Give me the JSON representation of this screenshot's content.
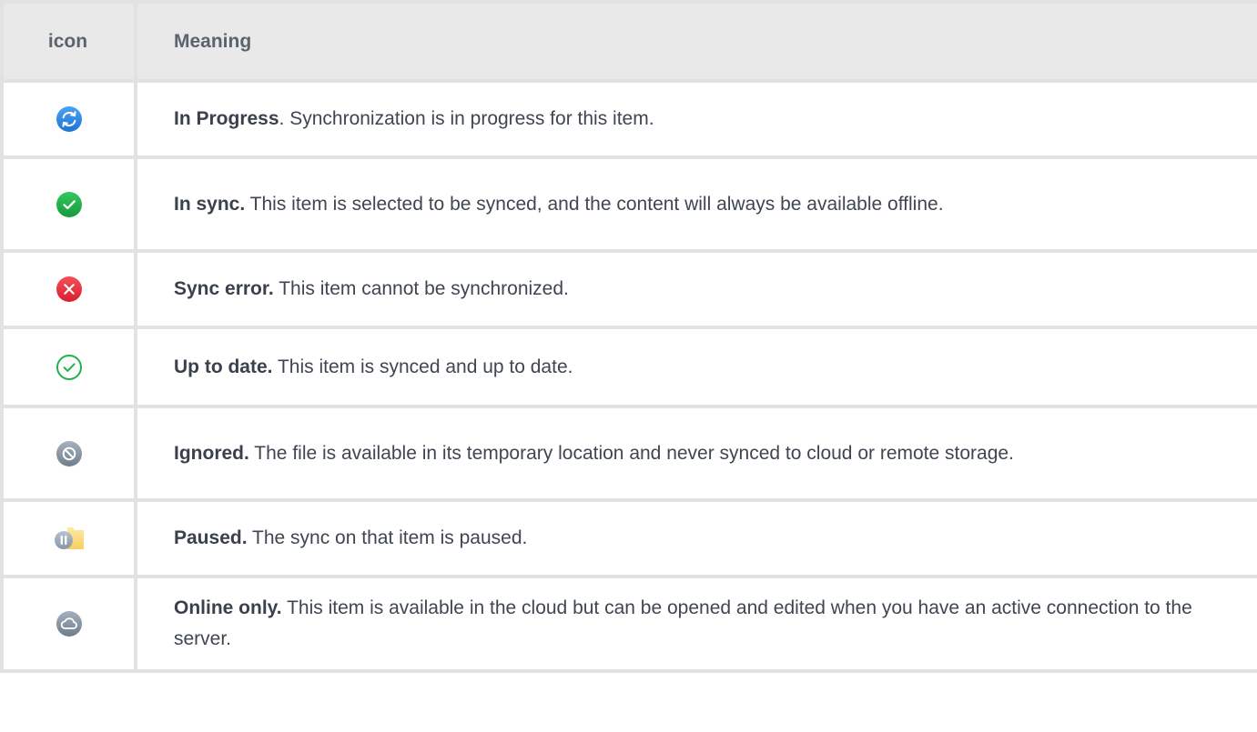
{
  "header": {
    "icon_label": "icon",
    "meaning_label": "Meaning"
  },
  "rows": [
    {
      "icon": "sync-in-progress-icon",
      "color": "#2f86e0",
      "title": "In Progress",
      "text": ". Synchronization is in progress for this item."
    },
    {
      "icon": "in-sync-check-icon",
      "color": "#22b24c",
      "title": "In sync.",
      "text": " This item is selected to be synced, and the content will always be available offline."
    },
    {
      "icon": "sync-error-icon",
      "color": "#e8323f",
      "title": "Sync error.",
      "text": " This item cannot be synchronized."
    },
    {
      "icon": "up-to-date-check-icon",
      "color": "#23b14d",
      "title": "Up to date.",
      "text": " This item is synced and up to date."
    },
    {
      "icon": "ignored-icon",
      "color": "#7f8c9a",
      "title": "Ignored.",
      "text": "  The file is available in its temporary location and never synced to cloud or remote storage."
    },
    {
      "icon": "paused-icon",
      "color": "#93a1b0",
      "title": "Paused.",
      "text": " The sync on that item is paused."
    },
    {
      "icon": "online-only-cloud-icon",
      "color": "#7f8d9b",
      "title": "Online only.",
      "text": " This item is available in the cloud but can be opened and edited when you have an active connection to the server."
    }
  ]
}
